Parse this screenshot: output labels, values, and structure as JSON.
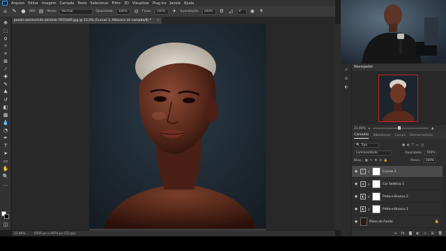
{
  "menu": {
    "items": [
      "Arquivo",
      "Editar",
      "Imagem",
      "Camada",
      "Texto",
      "Selecionar",
      "Filtro",
      "3D",
      "Visualizar",
      "Plug-ins",
      "Janela",
      "Ajuda"
    ]
  },
  "options": {
    "brush_size": "800",
    "mode_label": "Modo:",
    "mode_value": "Normal",
    "opacity_label": "Opacidade:",
    "opacity_value": "100%",
    "flow_label": "Fluxo:",
    "flow_value": "100%",
    "smoothing_label": "Suavização:",
    "smoothing_value": "100%",
    "angle_value": "0°"
  },
  "document": {
    "tab_title": "pexels-akintomide-akinlele-7655469.jpg @ 23,5% (Curvas 1, Máscara de camada/8) *",
    "close": "×"
  },
  "status": {
    "zoom": "23,46%",
    "dimensions": "5056 px x 6074 px (72 ppi)"
  },
  "navigator": {
    "title": "Navegador",
    "zoom": "23,46%"
  },
  "layers_panel": {
    "tabs": [
      "Camadas",
      "Bibliotecas",
      "Canais",
      "Demarcadores"
    ],
    "filter_kind": "Tipo",
    "blend_mode": "Luminosidade",
    "opacity_label": "Opacidade:",
    "opacity_value": "100%",
    "lock_label": "Bloq.:",
    "fill_label": "Preen.:",
    "fill_value": "100%",
    "layers": [
      {
        "name": "Curvas 1",
        "type": "curves",
        "selected": true
      },
      {
        "name": "Cor Seletiva 1",
        "type": "selective-color",
        "selected": false
      },
      {
        "name": "Preto-e-Branco 2",
        "type": "black-white",
        "selected": false
      },
      {
        "name": "Preto-e-Branco 1",
        "type": "black-white",
        "selected": false
      },
      {
        "name": "Plano de Fundo",
        "type": "background",
        "selected": false
      }
    ]
  },
  "colors": {
    "accent": "#31a8ff",
    "selected_layer": "#4a4a4a",
    "navigator_frame": "#d02020"
  }
}
